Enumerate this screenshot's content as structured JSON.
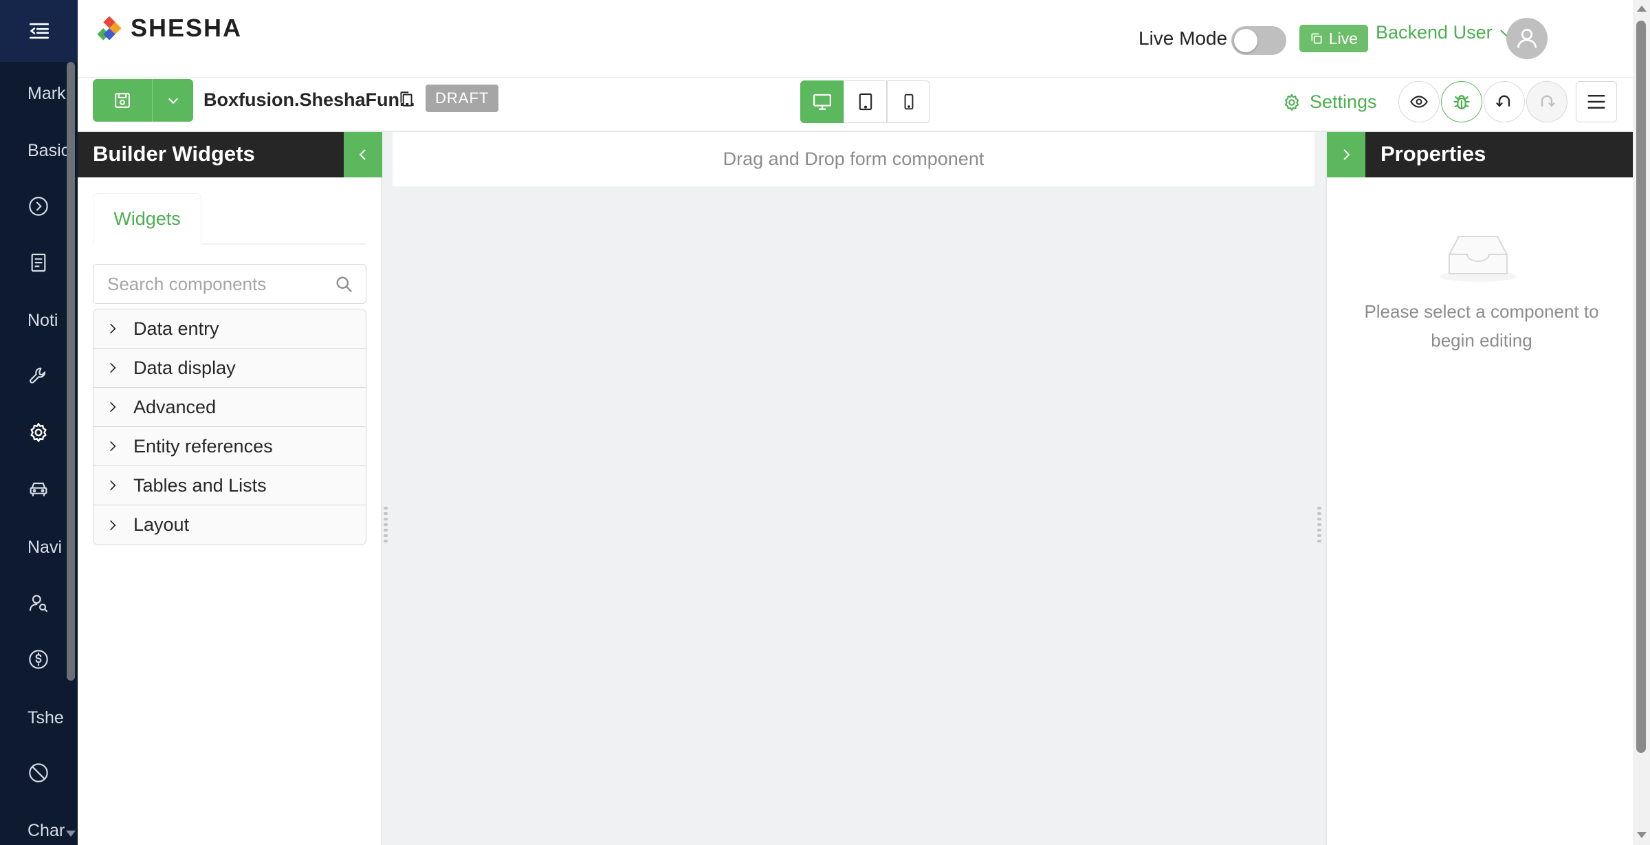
{
  "colors": {
    "accent": "#5cb85c",
    "sidebar_bg": "#0e1a30",
    "panel_header_bg": "#262626",
    "canvas_bg": "#f0f1f3"
  },
  "sidebar": {
    "items": [
      {
        "label": "Mark",
        "icon": null
      },
      {
        "label": "Basic",
        "icon": null
      },
      {
        "label": "",
        "icon": "play-circle-icon"
      },
      {
        "label": "",
        "icon": "document-icon"
      },
      {
        "label": "Noti",
        "icon": null
      },
      {
        "label": "",
        "icon": "wrench-icon"
      },
      {
        "label": "",
        "icon": "gear-icon"
      },
      {
        "label": "",
        "icon": "car-icon"
      },
      {
        "label": "Navi",
        "icon": null
      },
      {
        "label": "",
        "icon": "user-search-icon"
      },
      {
        "label": "",
        "icon": "dollar-circle-icon"
      },
      {
        "label": "Tshe",
        "icon": null
      },
      {
        "label": "",
        "icon": "stop-icon"
      },
      {
        "label": "Char",
        "icon": null
      }
    ]
  },
  "header": {
    "logo_text": "SHESHA",
    "live_mode_label": "Live Mode",
    "live_badge_label": "Live",
    "user_name": "Backend User"
  },
  "toolbar": {
    "form_name": "Boxfusion.SheshaFun...",
    "status_badge": "DRAFT",
    "settings_label": "Settings"
  },
  "builder_panel": {
    "title": "Builder Widgets",
    "tab_label": "Widgets",
    "search_placeholder": "Search components",
    "categories": [
      "Data entry",
      "Data display",
      "Advanced",
      "Entity references",
      "Tables and Lists",
      "Layout"
    ]
  },
  "canvas": {
    "drop_hint": "Drag and Drop form component"
  },
  "properties_panel": {
    "title": "Properties",
    "empty_text": "Please select a component to begin editing"
  }
}
